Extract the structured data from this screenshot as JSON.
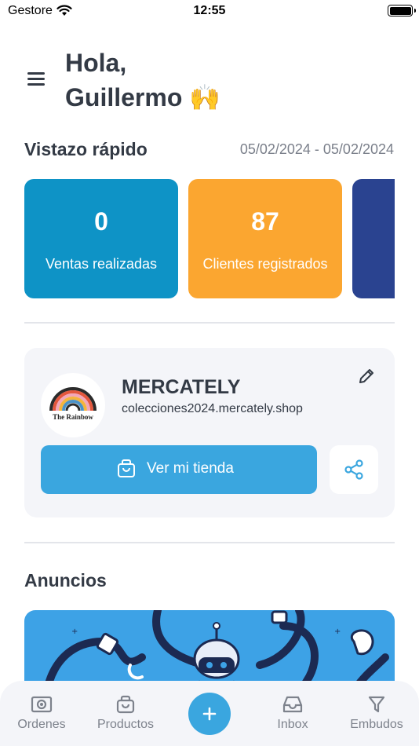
{
  "status_bar": {
    "carrier": "Gestore",
    "time": "12:55"
  },
  "header": {
    "greeting_line1": "Hola,",
    "greeting_line2": "Guillermo 🙌"
  },
  "quick_view": {
    "title": "Vistazo rápido",
    "date_range": "05/02/2024 - 05/02/2024",
    "cards": [
      {
        "value": "0",
        "label": "Ventas realizadas",
        "color": "#0e93c6"
      },
      {
        "value": "87",
        "label": "Clientes registrados",
        "color": "#fba630"
      },
      {
        "color": "#2a4390"
      }
    ]
  },
  "store": {
    "name": "MERCATELY",
    "url": "colecciones2024.mercately.shop",
    "logo_text": "The Rainbow",
    "view_button_label": "Ver mi tienda"
  },
  "announcements": {
    "title": "Anuncios"
  },
  "bottom_nav": {
    "items": [
      {
        "label": "Ordenes",
        "icon": "orders-icon"
      },
      {
        "label": "Productos",
        "icon": "shopping-bag-icon"
      },
      {
        "label": "Inbox",
        "icon": "inbox-icon"
      },
      {
        "label": "Embudos",
        "icon": "funnel-icon"
      }
    ]
  },
  "colors": {
    "accent": "#3aa6df",
    "text": "#333a45",
    "muted": "#7a7f8a",
    "nav_bg": "#f4f5f9"
  }
}
